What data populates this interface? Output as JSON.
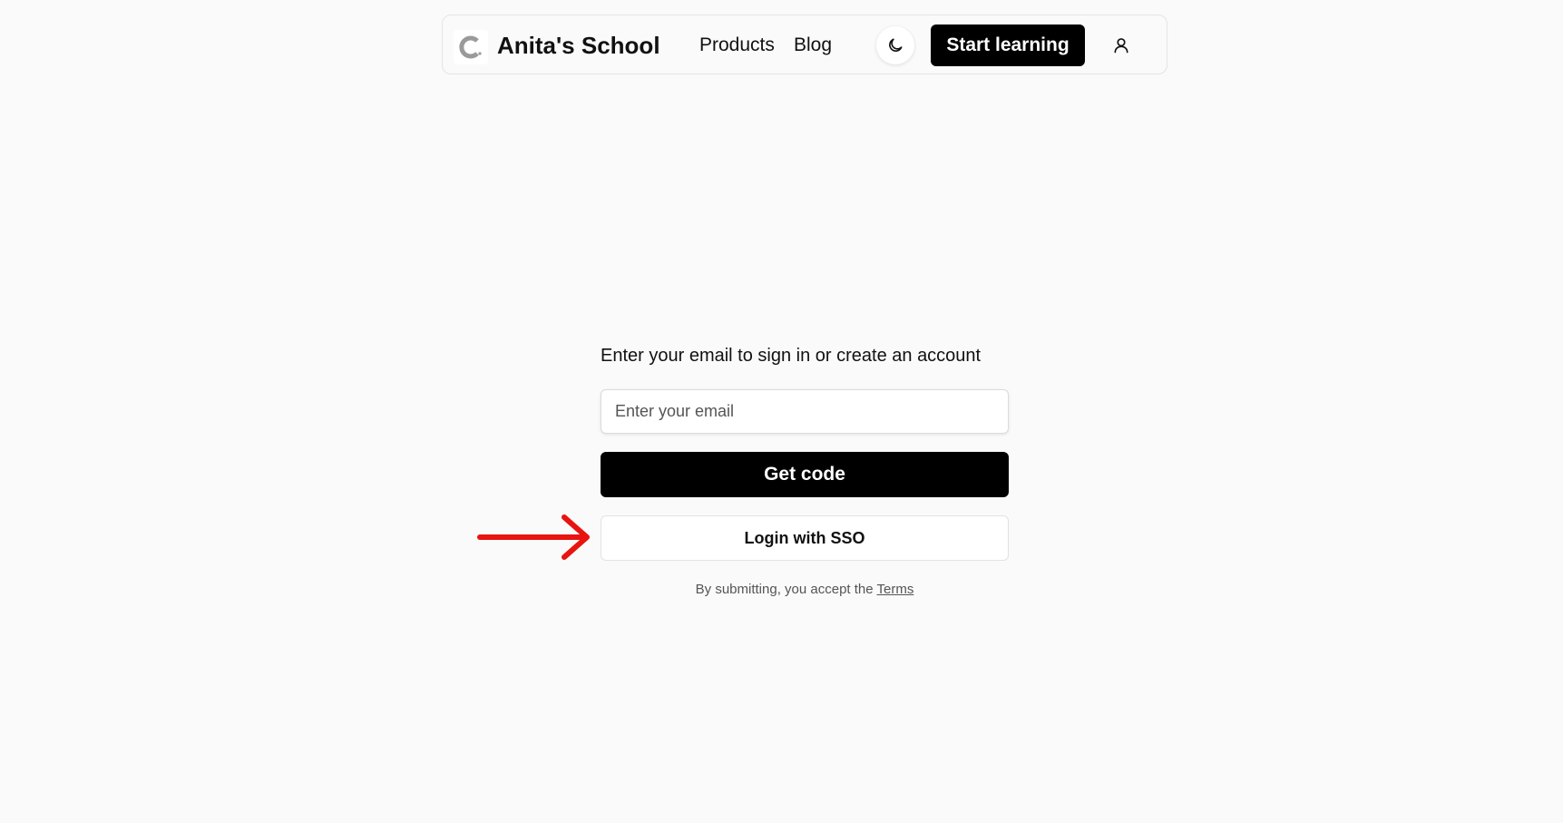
{
  "header": {
    "brand": "Anita's School",
    "nav": [
      {
        "label": "Products"
      },
      {
        "label": "Blog"
      }
    ],
    "cta_label": "Start learning",
    "icons": {
      "logo": "logo-c-icon",
      "theme": "moon-icon",
      "user": "user-icon"
    }
  },
  "form": {
    "title": "Enter your email to sign in or create an account",
    "email_placeholder": "Enter your email",
    "email_value": "",
    "get_code_label": "Get code",
    "sso_label": "Login with SSO",
    "terms_prefix": "By submitting, you accept the ",
    "terms_link": "Terms"
  },
  "annotation": {
    "arrow_color": "#e8140f",
    "icon": "arrow-right-icon"
  },
  "colors": {
    "background": "#fafafa",
    "primary": "#000000",
    "primary_text": "#ffffff"
  }
}
